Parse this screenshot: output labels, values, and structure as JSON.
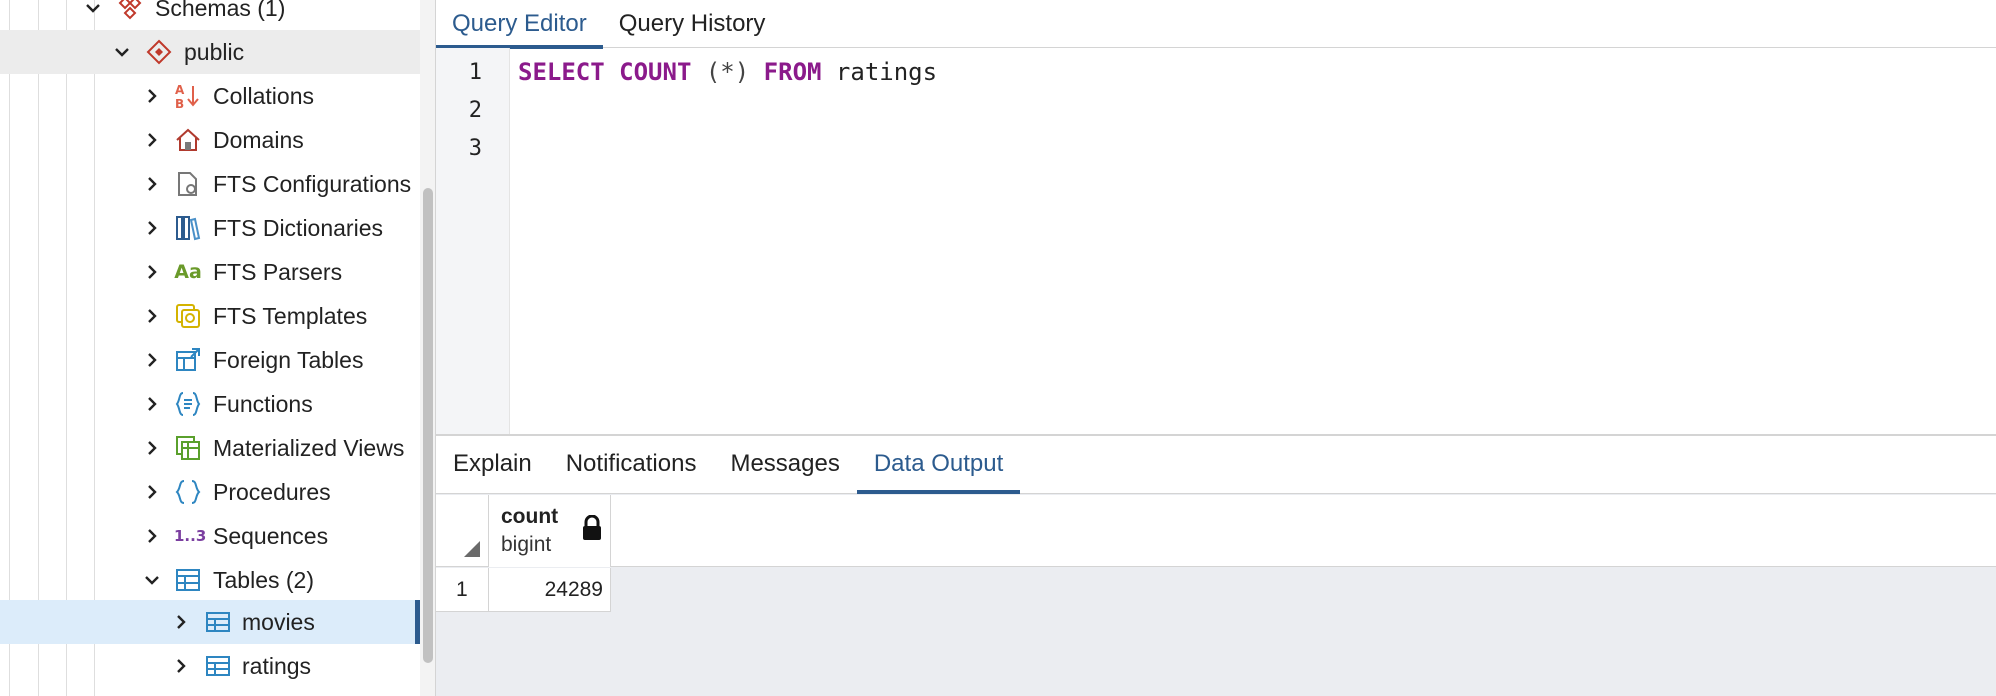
{
  "tree": {
    "items": [
      {
        "label": "Schemas (1)",
        "icon": "schemas-icon",
        "expanded": true
      },
      {
        "label": "public",
        "icon": "schema-icon",
        "expanded": true
      },
      {
        "label": "Collations",
        "icon": "collations-icon",
        "expanded": false
      },
      {
        "label": "Domains",
        "icon": "domains-icon",
        "expanded": false
      },
      {
        "label": "FTS Configurations",
        "icon": "fts-configurations-icon",
        "expanded": false
      },
      {
        "label": "FTS Dictionaries",
        "icon": "fts-dictionaries-icon",
        "expanded": false
      },
      {
        "label": "FTS Parsers",
        "icon": "fts-parsers-icon",
        "expanded": false
      },
      {
        "label": "FTS Templates",
        "icon": "fts-templates-icon",
        "expanded": false
      },
      {
        "label": "Foreign Tables",
        "icon": "foreign-tables-icon",
        "expanded": false
      },
      {
        "label": "Functions",
        "icon": "functions-icon",
        "expanded": false
      },
      {
        "label": "Materialized Views",
        "icon": "materialized-views-icon",
        "expanded": false
      },
      {
        "label": "Procedures",
        "icon": "procedures-icon",
        "expanded": false
      },
      {
        "label": "Sequences",
        "icon": "sequences-icon",
        "expanded": false
      },
      {
        "label": "Tables (2)",
        "icon": "tables-icon",
        "expanded": true
      },
      {
        "label": "movies",
        "icon": "table-icon",
        "expanded": false,
        "selected": true
      },
      {
        "label": "ratings",
        "icon": "table-icon",
        "expanded": false
      }
    ],
    "fts_parsers_glyph": "Aa",
    "sequences_glyph": "1..3"
  },
  "editor": {
    "tabs": [
      {
        "label": "Query Editor",
        "active": true
      },
      {
        "label": "Query History",
        "active": false
      }
    ],
    "line_numbers": [
      "1",
      "2",
      "3"
    ],
    "code": {
      "kw_select": "SELECT",
      "kw_count": "COUNT",
      "args": "(*)",
      "kw_from": "FROM",
      "table": "ratings"
    }
  },
  "output": {
    "tabs": [
      {
        "label": "Explain",
        "active": false
      },
      {
        "label": "Notifications",
        "active": false
      },
      {
        "label": "Messages",
        "active": false
      },
      {
        "label": "Data Output",
        "active": true
      }
    ],
    "columns": [
      {
        "name": "count",
        "type": "bigint",
        "locked": true
      }
    ],
    "rows": [
      {
        "num": "1",
        "values": [
          "24289"
        ]
      }
    ]
  },
  "colors": {
    "accent": "#2c5b8e",
    "keyword": "#8b1a8b",
    "selected_row": "#dcecfa"
  }
}
